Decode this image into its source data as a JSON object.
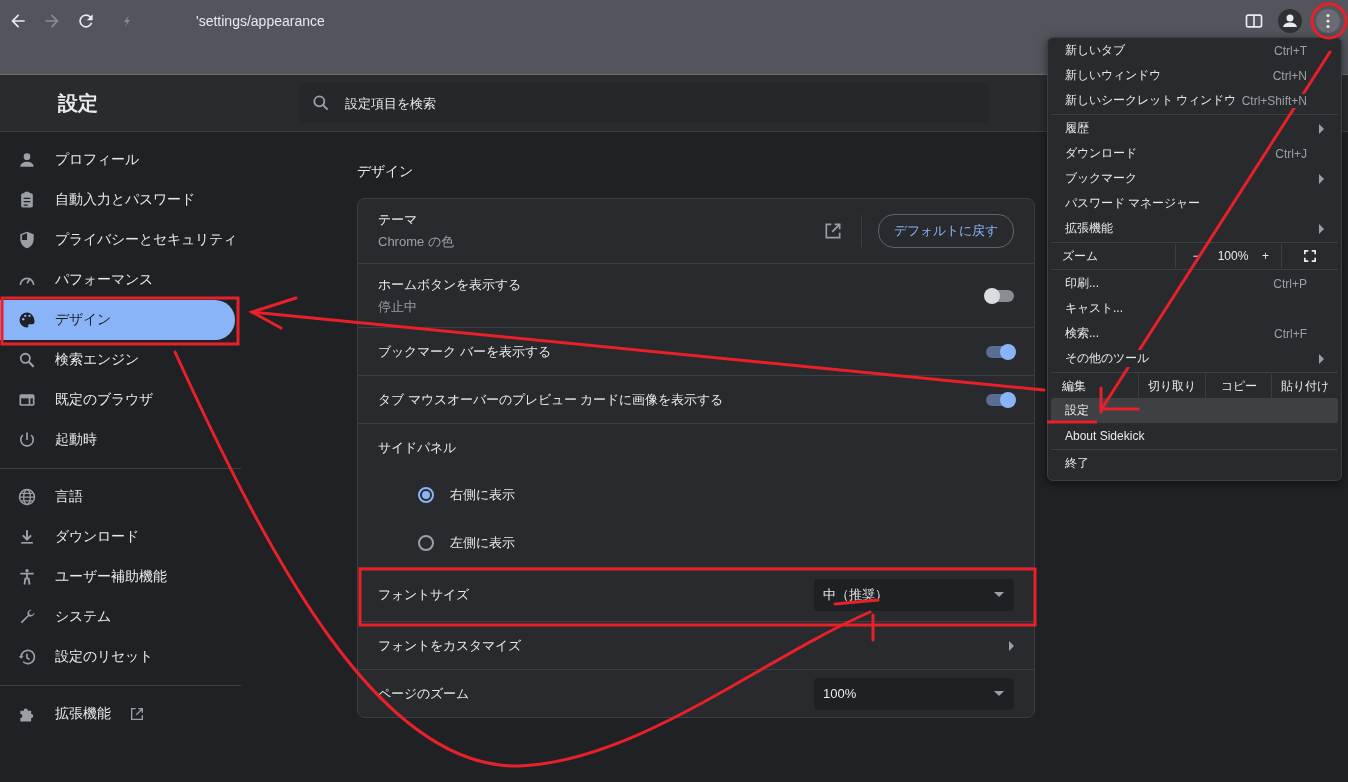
{
  "browser": {
    "address": "'settings/appearance",
    "forward_enabled": false
  },
  "settings_header": {
    "title": "設定",
    "search": {
      "placeholder": "設定項目を検索"
    }
  },
  "sidebar": {
    "sections": [
      {
        "items": [
          {
            "label": "プロフィール",
            "selected": false
          },
          {
            "label": "自動入力とパスワード",
            "selected": false
          },
          {
            "label": "プライバシーとセキュリティ",
            "selected": false
          },
          {
            "label": "パフォーマンス",
            "selected": false
          },
          {
            "label": "デザイン",
            "selected": true
          },
          {
            "label": "検索エンジン",
            "selected": false
          },
          {
            "label": "既定のブラウザ",
            "selected": false
          },
          {
            "label": "起動時",
            "selected": false
          }
        ]
      },
      {
        "items": [
          {
            "label": "言語",
            "selected": false
          },
          {
            "label": "ダウンロード",
            "selected": false
          },
          {
            "label": "ユーザー補助機能",
            "selected": false
          },
          {
            "label": "システム",
            "selected": false
          },
          {
            "label": "設定のリセット",
            "selected": false
          }
        ]
      },
      {
        "items": [
          {
            "label": "拡張機能",
            "selected": false,
            "external": true
          }
        ]
      }
    ]
  },
  "main": {
    "section_title": "デザイン",
    "rows": [
      {
        "kind": "theme",
        "label": "テーマ",
        "sublabel": "Chrome の色",
        "button": "デフォルトに戻す"
      },
      {
        "kind": "toggle",
        "label": "ホームボタンを表示する",
        "sublabel": "停止中",
        "on": false
      },
      {
        "kind": "toggle",
        "label": "ブックマーク バーを表示する",
        "on": true
      },
      {
        "kind": "toggle",
        "label": "タブ マウスオーバーのプレビュー カードに画像を表示する",
        "on": true
      },
      {
        "kind": "heading",
        "label": "サイドパネル"
      },
      {
        "kind": "radio",
        "label": "右側に表示",
        "selected": true
      },
      {
        "kind": "radio",
        "label": "左側に表示",
        "selected": false
      },
      {
        "kind": "select",
        "label": "フォントサイズ",
        "value": "中（推奨）"
      },
      {
        "kind": "submenu",
        "label": "フォントをカスタマイズ"
      },
      {
        "kind": "select",
        "label": "ページのズーム",
        "value": "100%"
      }
    ]
  },
  "menu": {
    "items": [
      {
        "kind": "item",
        "label": "新しいタブ",
        "shortcut": "Ctrl+T",
        "selected": false
      },
      {
        "kind": "item",
        "label": "新しいウィンドウ",
        "shortcut": "Ctrl+N",
        "selected": false
      },
      {
        "kind": "item",
        "label": "新しいシークレット ウィンドウ",
        "shortcut": "Ctrl+Shift+N",
        "selected": false
      },
      {
        "kind": "separator"
      },
      {
        "kind": "item",
        "label": "履歴",
        "submenu": true,
        "selected": false
      },
      {
        "kind": "item",
        "label": "ダウンロード",
        "shortcut": "Ctrl+J",
        "selected": false
      },
      {
        "kind": "item",
        "label": "ブックマーク",
        "submenu": true,
        "selected": false
      },
      {
        "kind": "item",
        "label": "パスワード マネージャー",
        "selected": false
      },
      {
        "kind": "item",
        "label": "拡張機能",
        "submenu": true,
        "selected": false
      },
      {
        "kind": "separator"
      },
      {
        "kind": "zoom",
        "label": "ズーム",
        "minus": "−",
        "value": "100%",
        "plus": "+"
      },
      {
        "kind": "separator"
      },
      {
        "kind": "item",
        "label": "印刷...",
        "shortcut": "Ctrl+P",
        "selected": false
      },
      {
        "kind": "item",
        "label": "キャスト...",
        "selected": false
      },
      {
        "kind": "item",
        "label": "検索...",
        "shortcut": "Ctrl+F",
        "selected": false
      },
      {
        "kind": "item",
        "label": "その他のツール",
        "submenu": true,
        "selected": false
      },
      {
        "kind": "separator"
      },
      {
        "kind": "edit",
        "label": "編集",
        "buttons": [
          "切り取り",
          "コピー",
          "貼り付け"
        ]
      },
      {
        "kind": "item",
        "label": "設定",
        "selected": true
      },
      {
        "kind": "item",
        "label": "About Sidekick",
        "selected": false
      },
      {
        "kind": "separator"
      },
      {
        "kind": "item",
        "label": "終了",
        "selected": false
      }
    ]
  }
}
